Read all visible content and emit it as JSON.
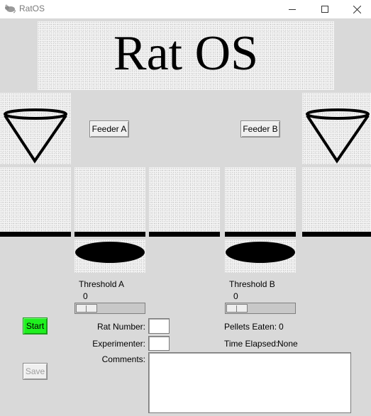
{
  "window": {
    "title": "RatOS",
    "icon": "rat-icon",
    "minimize_icon": "minimize-icon",
    "maximize_icon": "maximize-icon",
    "close_icon": "close-icon"
  },
  "banner": {
    "title": "Rat OS"
  },
  "feeders": {
    "a_label": "Feeder A",
    "b_label": "Feeder B",
    "cone_icon": "feeder-cone-icon"
  },
  "threshold_a": {
    "label": "Threshold A",
    "value": 0,
    "min": 0
  },
  "threshold_b": {
    "label": "Threshold B",
    "value": 0,
    "min": 0
  },
  "controls": {
    "start_label": "Start",
    "save_label": "Save",
    "start_color": "#1ff01f"
  },
  "form": {
    "rat_number_label": "Rat Number:",
    "rat_number_value": "",
    "experimenter_label": "Experimenter:",
    "experimenter_value": "",
    "comments_label": "Comments:",
    "comments_value": ""
  },
  "stats": {
    "pellets_label": "Pellets Eaten:",
    "pellets_value": "0",
    "time_label": "Time Elapsed:",
    "time_value": "None"
  }
}
